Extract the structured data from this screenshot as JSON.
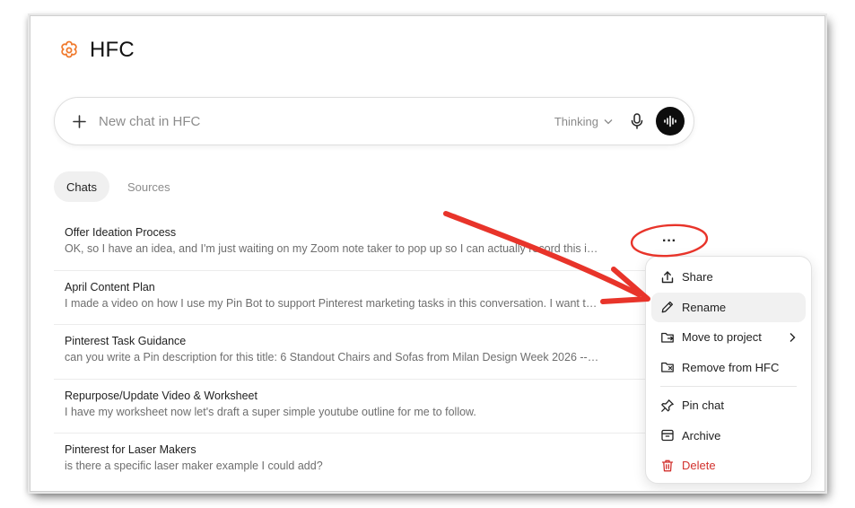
{
  "app": {
    "title": "HFC",
    "accent": "#f07a2d"
  },
  "composer": {
    "placeholder": "New chat in HFC",
    "value": "",
    "mode_label": "Thinking"
  },
  "tabs": [
    {
      "label": "Chats",
      "active": true
    },
    {
      "label": "Sources",
      "active": false
    }
  ],
  "chats": [
    {
      "title": "Offer Ideation Process",
      "preview": "OK, so I have an idea, and I'm just waiting on my Zoom note taker to pop up so I can actually record this i…"
    },
    {
      "title": "April Content Plan",
      "preview": "I made a video on how I use my Pin Bot to support Pinterest marketing tasks in this conversation. I want t…"
    },
    {
      "title": "Pinterest Task Guidance",
      "preview": "can you write a Pin description for this title: 6 Standout Chairs and Sofas from Milan Design Week 2026 --…"
    },
    {
      "title": "Repurpose/Update Video & Worksheet",
      "preview": "I have my worksheet now let's draft a super simple youtube outline for me to follow."
    },
    {
      "title": "Pinterest for Laser Makers",
      "preview": "is there a specific laser maker example I could add?"
    }
  ],
  "more_button": {
    "label": "···"
  },
  "context_menu": {
    "items": [
      {
        "label": "Share",
        "icon": "share-icon"
      },
      {
        "label": "Rename",
        "icon": "pencil-icon",
        "highlighted": true
      },
      {
        "label": "Move to project",
        "icon": "folder-move-icon",
        "has_submenu": true
      },
      {
        "label": "Remove from HFC",
        "icon": "folder-remove-icon"
      },
      {
        "label": "Pin chat",
        "icon": "pin-icon"
      },
      {
        "label": "Archive",
        "icon": "archive-icon"
      },
      {
        "label": "Delete",
        "icon": "trash-icon",
        "danger": true
      }
    ]
  },
  "colors": {
    "annotation_red": "#e8342a",
    "danger": "#d2312d",
    "voice_button": "#0d0d0d"
  }
}
